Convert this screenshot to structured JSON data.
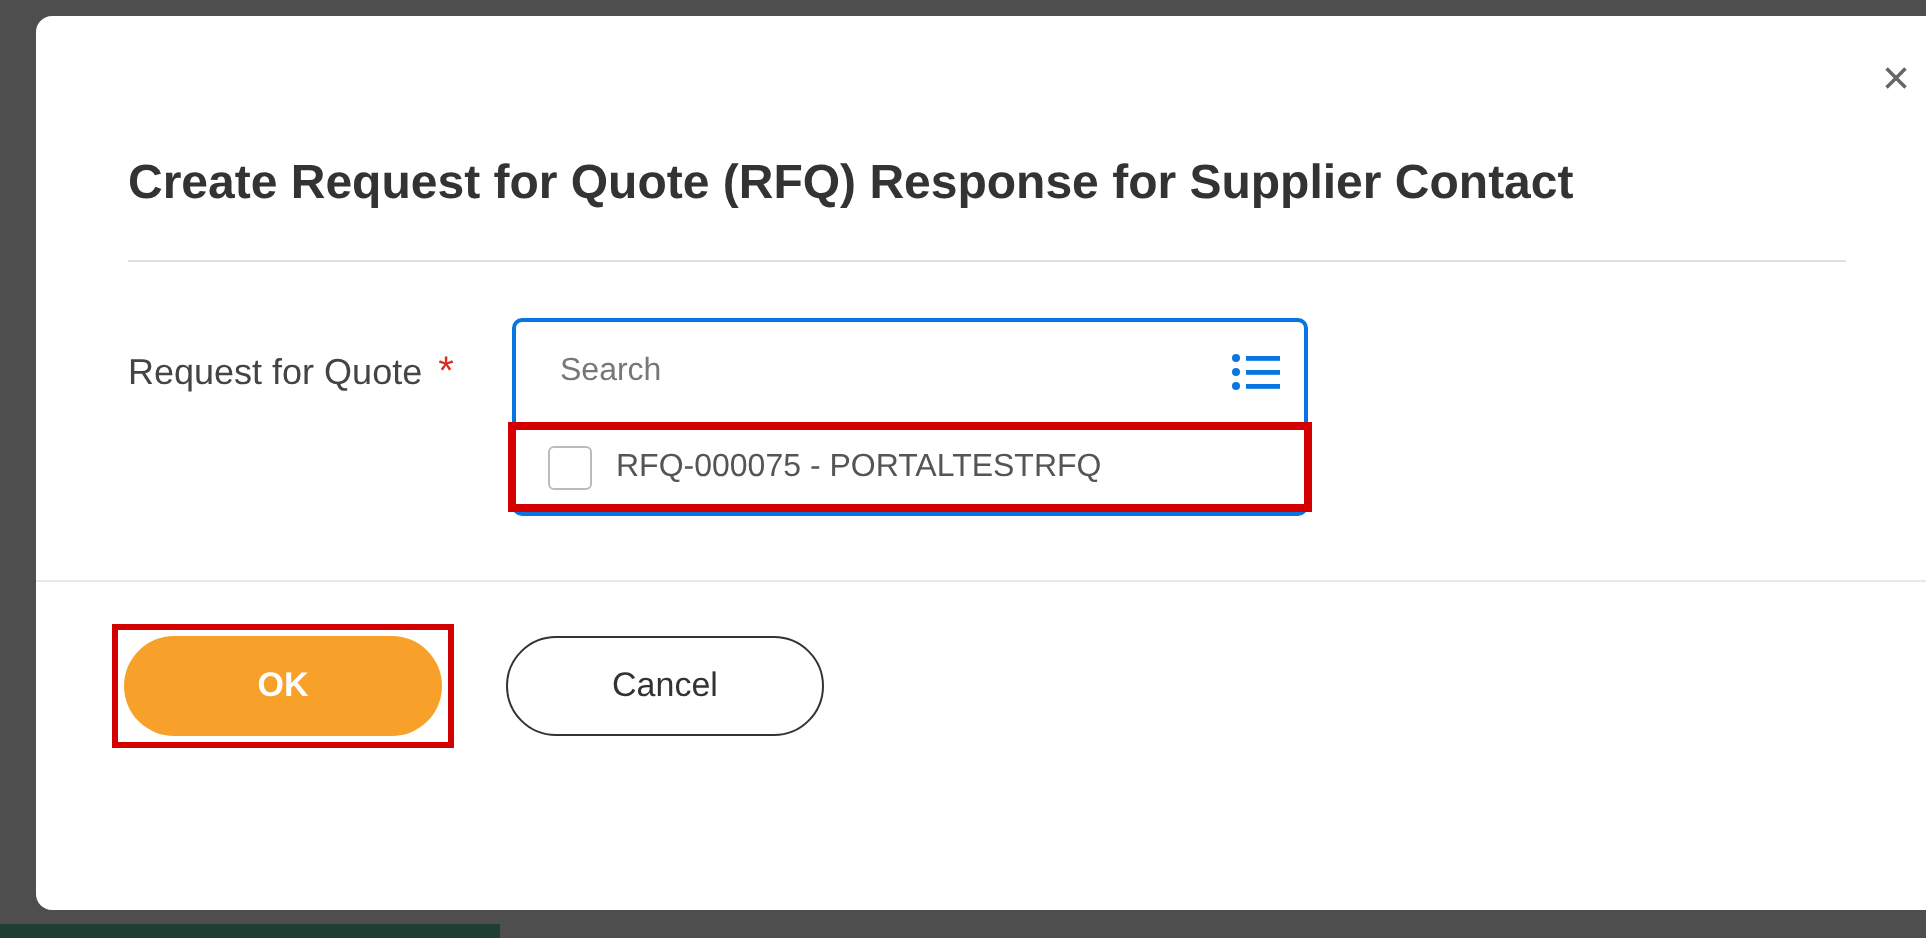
{
  "dialog": {
    "title": "Create Request for Quote (RFQ) Response for Supplier Contact",
    "close_label": "×"
  },
  "field": {
    "label": "Request for Quote",
    "required": true,
    "required_mark": "*",
    "placeholder": "Search",
    "options": [
      {
        "label": "RFQ-000075 - PORTALTESTRFQ",
        "checked": false,
        "highlighted": true
      }
    ]
  },
  "buttons": [
    {
      "label": "OK",
      "kind": "primary",
      "highlighted": true
    },
    {
      "label": "Cancel",
      "kind": "secondary",
      "highlighted": false
    }
  ]
}
